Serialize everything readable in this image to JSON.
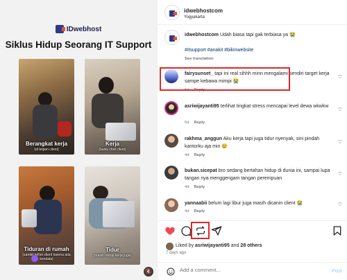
{
  "media": {
    "brand": "IDwebhost",
    "title": "Siklus Hidup Seorang IT Support",
    "tiles": [
      {
        "caption": "Berangkat kerja",
        "sub": "(di telpon client)"
      },
      {
        "caption": "Kerja",
        "sub": "(bales chat client)"
      },
      {
        "caption": "Tiduran di rumah",
        "sub": "(sambil telfon client karena ada kendala)"
      },
      {
        "caption": "Tidur",
        "sub": "(masih mimpi kerja juga)"
      }
    ]
  },
  "post": {
    "username": "idwebhostcom",
    "location": "Yogyakarta",
    "caption_user": "idwebhostcom",
    "caption_text": "Udah biasa tapi gak terbiasa ya 😭",
    "hashtags": "#itsupport #anakit #bikinwebsite",
    "see_translation": "See translation"
  },
  "comments": [
    {
      "user": "fairysunset_",
      "text": "tapi ini real sihhh minn mengalami sendiri target kerja sampe kebawa mimpi 😭",
      "time": "6d",
      "reply": "Reply"
    },
    {
      "user": "asriwijayanti95",
      "text": "terlihat tingkat stress mencapai level dewa wkwkw",
      "time": "6d",
      "reply": "Reply"
    },
    {
      "user": "rakhma_anggun",
      "text": "Aku kerja tapi juga tidur nyenyak, sini pindah kantorku aja min 😢",
      "time": "4d",
      "reply": "Reply"
    },
    {
      "user": "bukan.sicepat",
      "text": "bro sedang bertahan hidup di dunia ini, sampai lupa tangan nya menggengam tangan perempuan",
      "time": "4d",
      "reply": "Reply"
    },
    {
      "user": "yannaabii",
      "text": "belum lagi libur juga masih dicanin client 😭",
      "time": "4d",
      "reply": "Reply"
    }
  ],
  "likes": {
    "prefix": "Liked by ",
    "user": "asriwijayanti95",
    "middle": " and ",
    "others": "28 others"
  },
  "ago": "7 days ago",
  "add_comment": {
    "placeholder": "Add a comment...",
    "post_label": "Post"
  },
  "colors": {
    "highlight": "#e0262b",
    "link": "#00376b",
    "like": "#ed4956"
  }
}
